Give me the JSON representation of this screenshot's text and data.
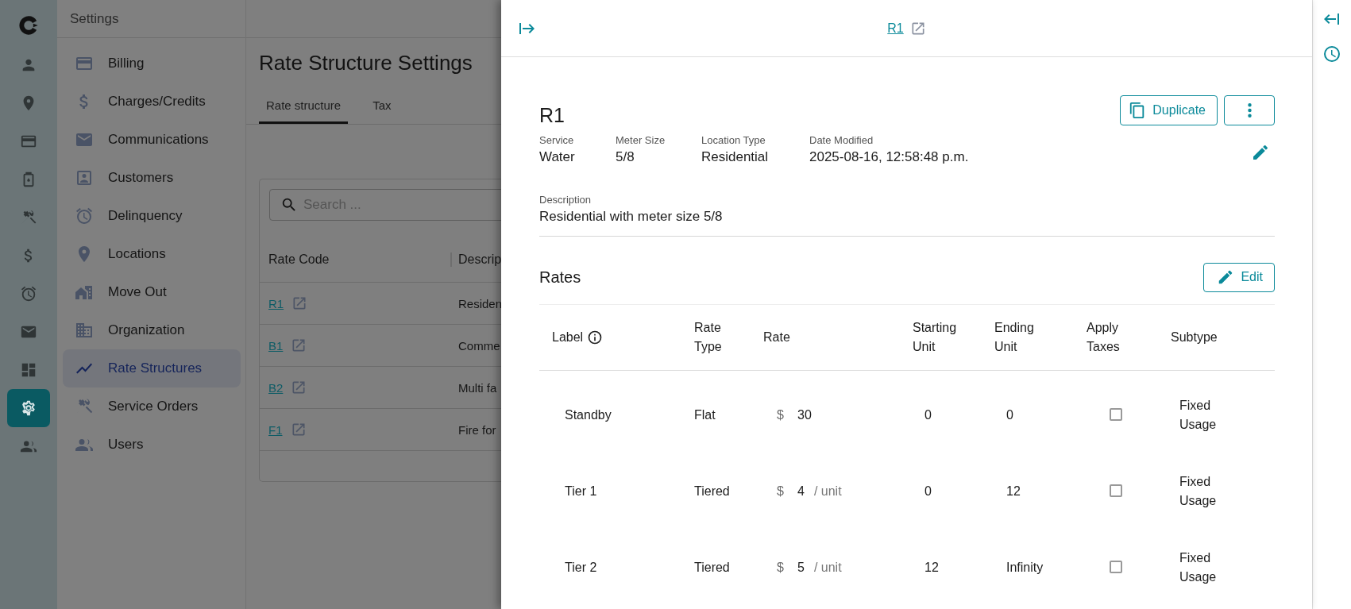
{
  "rail": {
    "items": [
      {
        "selected": false
      },
      {
        "selected": false
      },
      {
        "selected": false
      },
      {
        "selected": false
      },
      {
        "selected": false
      },
      {
        "selected": false
      },
      {
        "selected": false
      },
      {
        "selected": false
      },
      {
        "selected": false
      },
      {
        "selected": true
      },
      {
        "selected": false
      }
    ]
  },
  "settings_nav": {
    "title": "Settings",
    "items": [
      {
        "label": "Billing",
        "selected": false
      },
      {
        "label": "Charges/Credits",
        "selected": false
      },
      {
        "label": "Communications",
        "selected": false
      },
      {
        "label": "Customers",
        "selected": false
      },
      {
        "label": "Delinquency",
        "selected": false
      },
      {
        "label": "Locations",
        "selected": false
      },
      {
        "label": "Move Out",
        "selected": false
      },
      {
        "label": "Organization",
        "selected": false
      },
      {
        "label": "Rate Structures",
        "selected": true
      },
      {
        "label": "Service Orders",
        "selected": false
      },
      {
        "label": "Users",
        "selected": false
      }
    ]
  },
  "page": {
    "title": "Rate Structure Settings",
    "tabs": [
      {
        "label": "Rate structure",
        "selected": true
      },
      {
        "label": "Tax",
        "selected": false
      }
    ],
    "search": {
      "placeholder": "Search ..."
    },
    "table": {
      "columns": [
        "Rate Code",
        "Descrip"
      ],
      "rows": [
        {
          "code": "R1",
          "description": "Residen"
        },
        {
          "code": "B1",
          "description": "Comme"
        },
        {
          "code": "B2",
          "description": "Multi fa"
        },
        {
          "code": "F1",
          "description": "Fire for"
        }
      ]
    }
  },
  "panel": {
    "header_link": "R1",
    "title": "R1",
    "duplicate_label": "Duplicate",
    "fields": [
      {
        "label": "Service",
        "value": "Water"
      },
      {
        "label": "Meter Size",
        "value": "5/8"
      },
      {
        "label": "Location Type",
        "value": "Residential"
      },
      {
        "label": "Date Modified",
        "value": "2025-08-16, 12:58:48 p.m."
      }
    ],
    "description": {
      "label": "Description",
      "value": "Residential with meter size 5/8"
    },
    "rates": {
      "title": "Rates",
      "edit_label": "Edit",
      "columns": [
        "Label",
        "Rate Type",
        "Rate",
        "Starting Unit",
        "Ending Unit",
        "Apply Taxes",
        "Subtype"
      ],
      "rows": [
        {
          "label": "Standby",
          "rate_type": "Flat",
          "currency": "$",
          "amount": "30",
          "starting_unit": "0",
          "ending_unit": "0",
          "apply_taxes": false,
          "subtype": "Fixed Usage"
        },
        {
          "label": "Tier 1",
          "rate_type": "Tiered",
          "currency": "$",
          "amount": "4",
          "unit": "/ unit",
          "starting_unit": "0",
          "ending_unit": "12",
          "apply_taxes": false,
          "subtype": "Fixed Usage"
        },
        {
          "label": "Tier 2",
          "rate_type": "Tiered",
          "currency": "$",
          "amount": "5",
          "unit": "/ unit",
          "starting_unit": "12",
          "ending_unit": "Infinity",
          "apply_taxes": false,
          "subtype": "Fixed Usage"
        }
      ]
    }
  }
}
